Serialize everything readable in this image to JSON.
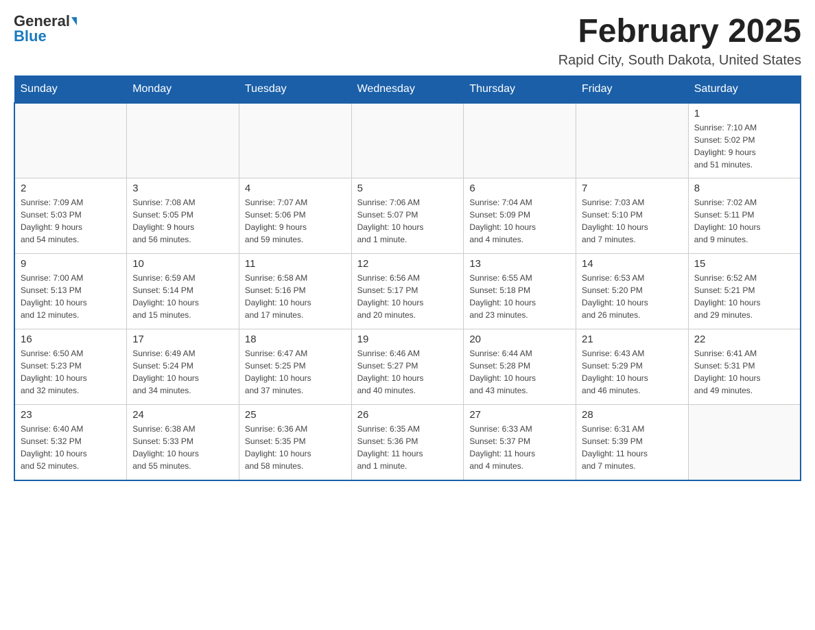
{
  "logo": {
    "general": "General",
    "blue": "Blue"
  },
  "title": "February 2025",
  "subtitle": "Rapid City, South Dakota, United States",
  "days_of_week": [
    "Sunday",
    "Monday",
    "Tuesday",
    "Wednesday",
    "Thursday",
    "Friday",
    "Saturday"
  ],
  "weeks": [
    [
      {
        "day": "",
        "info": ""
      },
      {
        "day": "",
        "info": ""
      },
      {
        "day": "",
        "info": ""
      },
      {
        "day": "",
        "info": ""
      },
      {
        "day": "",
        "info": ""
      },
      {
        "day": "",
        "info": ""
      },
      {
        "day": "1",
        "info": "Sunrise: 7:10 AM\nSunset: 5:02 PM\nDaylight: 9 hours\nand 51 minutes."
      }
    ],
    [
      {
        "day": "2",
        "info": "Sunrise: 7:09 AM\nSunset: 5:03 PM\nDaylight: 9 hours\nand 54 minutes."
      },
      {
        "day": "3",
        "info": "Sunrise: 7:08 AM\nSunset: 5:05 PM\nDaylight: 9 hours\nand 56 minutes."
      },
      {
        "day": "4",
        "info": "Sunrise: 7:07 AM\nSunset: 5:06 PM\nDaylight: 9 hours\nand 59 minutes."
      },
      {
        "day": "5",
        "info": "Sunrise: 7:06 AM\nSunset: 5:07 PM\nDaylight: 10 hours\nand 1 minute."
      },
      {
        "day": "6",
        "info": "Sunrise: 7:04 AM\nSunset: 5:09 PM\nDaylight: 10 hours\nand 4 minutes."
      },
      {
        "day": "7",
        "info": "Sunrise: 7:03 AM\nSunset: 5:10 PM\nDaylight: 10 hours\nand 7 minutes."
      },
      {
        "day": "8",
        "info": "Sunrise: 7:02 AM\nSunset: 5:11 PM\nDaylight: 10 hours\nand 9 minutes."
      }
    ],
    [
      {
        "day": "9",
        "info": "Sunrise: 7:00 AM\nSunset: 5:13 PM\nDaylight: 10 hours\nand 12 minutes."
      },
      {
        "day": "10",
        "info": "Sunrise: 6:59 AM\nSunset: 5:14 PM\nDaylight: 10 hours\nand 15 minutes."
      },
      {
        "day": "11",
        "info": "Sunrise: 6:58 AM\nSunset: 5:16 PM\nDaylight: 10 hours\nand 17 minutes."
      },
      {
        "day": "12",
        "info": "Sunrise: 6:56 AM\nSunset: 5:17 PM\nDaylight: 10 hours\nand 20 minutes."
      },
      {
        "day": "13",
        "info": "Sunrise: 6:55 AM\nSunset: 5:18 PM\nDaylight: 10 hours\nand 23 minutes."
      },
      {
        "day": "14",
        "info": "Sunrise: 6:53 AM\nSunset: 5:20 PM\nDaylight: 10 hours\nand 26 minutes."
      },
      {
        "day": "15",
        "info": "Sunrise: 6:52 AM\nSunset: 5:21 PM\nDaylight: 10 hours\nand 29 minutes."
      }
    ],
    [
      {
        "day": "16",
        "info": "Sunrise: 6:50 AM\nSunset: 5:23 PM\nDaylight: 10 hours\nand 32 minutes."
      },
      {
        "day": "17",
        "info": "Sunrise: 6:49 AM\nSunset: 5:24 PM\nDaylight: 10 hours\nand 34 minutes."
      },
      {
        "day": "18",
        "info": "Sunrise: 6:47 AM\nSunset: 5:25 PM\nDaylight: 10 hours\nand 37 minutes."
      },
      {
        "day": "19",
        "info": "Sunrise: 6:46 AM\nSunset: 5:27 PM\nDaylight: 10 hours\nand 40 minutes."
      },
      {
        "day": "20",
        "info": "Sunrise: 6:44 AM\nSunset: 5:28 PM\nDaylight: 10 hours\nand 43 minutes."
      },
      {
        "day": "21",
        "info": "Sunrise: 6:43 AM\nSunset: 5:29 PM\nDaylight: 10 hours\nand 46 minutes."
      },
      {
        "day": "22",
        "info": "Sunrise: 6:41 AM\nSunset: 5:31 PM\nDaylight: 10 hours\nand 49 minutes."
      }
    ],
    [
      {
        "day": "23",
        "info": "Sunrise: 6:40 AM\nSunset: 5:32 PM\nDaylight: 10 hours\nand 52 minutes."
      },
      {
        "day": "24",
        "info": "Sunrise: 6:38 AM\nSunset: 5:33 PM\nDaylight: 10 hours\nand 55 minutes."
      },
      {
        "day": "25",
        "info": "Sunrise: 6:36 AM\nSunset: 5:35 PM\nDaylight: 10 hours\nand 58 minutes."
      },
      {
        "day": "26",
        "info": "Sunrise: 6:35 AM\nSunset: 5:36 PM\nDaylight: 11 hours\nand 1 minute."
      },
      {
        "day": "27",
        "info": "Sunrise: 6:33 AM\nSunset: 5:37 PM\nDaylight: 11 hours\nand 4 minutes."
      },
      {
        "day": "28",
        "info": "Sunrise: 6:31 AM\nSunset: 5:39 PM\nDaylight: 11 hours\nand 7 minutes."
      },
      {
        "day": "",
        "info": ""
      }
    ]
  ]
}
